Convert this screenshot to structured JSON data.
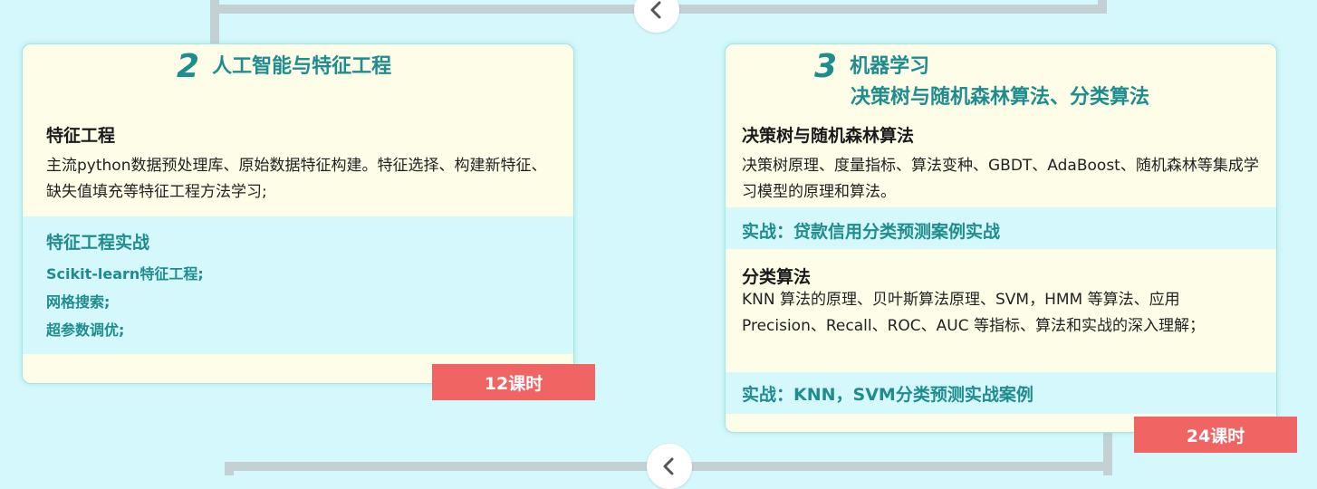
{
  "card2": {
    "number": "2",
    "title": "人工智能与特征工程",
    "section1": {
      "heading": "特征工程",
      "body": "主流python数据预处理库、原始数据特征构建。特征选择、构建新特征、缺失值填充等特征工程方法学习;"
    },
    "practice": {
      "title": "特征工程实战",
      "items": [
        "Scikit-learn特征工程;",
        "网格搜索;",
        "超参数调优;"
      ]
    },
    "hours": "12课时"
  },
  "card3": {
    "number": "3",
    "title_line1": "机器学习",
    "title_line2": "决策树与随机森林算法、分类算法",
    "section1": {
      "heading": "决策树与随机森林算法",
      "body": "决策树原理、度量指标、算法变种、GBDT、AdaBoost、随机森林等集成学习模型的原理和算法。"
    },
    "practice1": "实战：贷款信用分类预测案例实战",
    "section2": {
      "heading": "分类算法",
      "body": "KNN 算法的原理、贝叶斯算法原理、SVM，HMM 等算法、应用 Precision、Recall、ROC、AUC 等指标、算法和实战的深入理解；"
    },
    "practice2": "实战：KNN，SVM分类预测实战案例",
    "hours": "24课时"
  },
  "icons": {
    "nav_top": "chevron-left-icon",
    "nav_bottom": "chevron-left-icon"
  },
  "colors": {
    "background": "#d4f8fb",
    "accent": "#1f8c8e",
    "card": "#fdfde8",
    "badge": "#f06464",
    "connector": "#c3d1d5"
  }
}
